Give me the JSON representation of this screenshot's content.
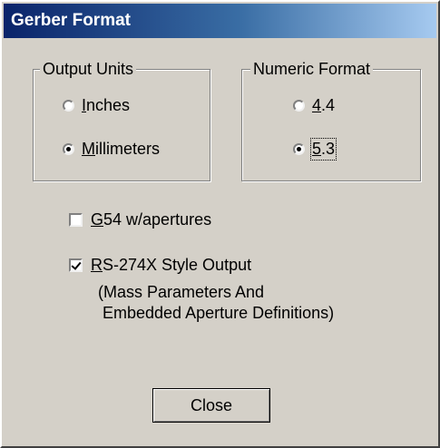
{
  "window": {
    "title": "Gerber Format"
  },
  "output_units": {
    "legend": "Output Units",
    "options": [
      {
        "label": "Inches",
        "mnemonic": "I",
        "rest": "nches",
        "selected": false
      },
      {
        "label": "Millimeters",
        "mnemonic": "M",
        "rest": "illimeters",
        "selected": true
      }
    ]
  },
  "numeric_format": {
    "legend": "Numeric Format",
    "options": [
      {
        "label": "4.4",
        "mnemonic": "4",
        "rest": ".4",
        "selected": false
      },
      {
        "label": "5.3",
        "mnemonic": "5",
        "rest": ".3",
        "selected": true
      }
    ]
  },
  "checkboxes": [
    {
      "label": "G54 w/apertures",
      "mnemonic": "G",
      "rest": "54 w/apertures",
      "checked": false
    },
    {
      "label": "RS-274X Style Output",
      "mnemonic": "R",
      "rest": "S-274X Style Output",
      "checked": true
    }
  ],
  "rs274x_note": {
    "line1": "(Mass Parameters And",
    "line2": " Embedded Aperture Definitions)"
  },
  "buttons": {
    "close_label": "Close"
  }
}
